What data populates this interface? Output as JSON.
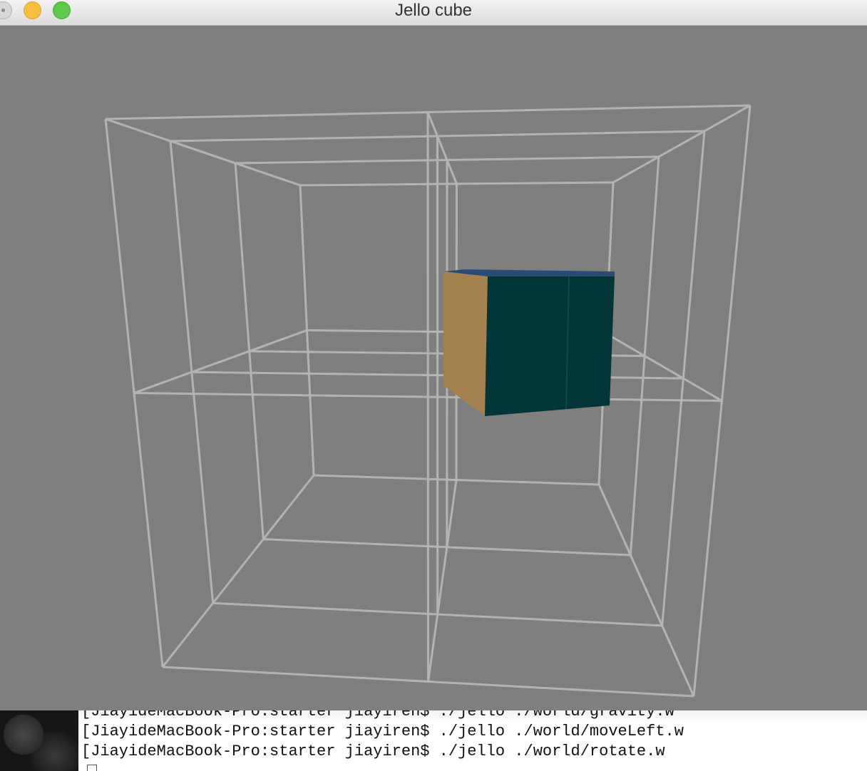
{
  "window": {
    "title": "Jello cube"
  },
  "colors": {
    "background": "#7f7f7f",
    "wireframe": "#b3b3b3",
    "cube_front": "#023537",
    "cube_side": "#a5814f",
    "cube_top": "#2a4a78"
  },
  "terminal": {
    "lines": [
      "[JiayideMacBook-Pro:starter jiayiren$ ./jello ./world/gravity.w",
      "[JiayideMacBook-Pro:starter jiayiren$ ./jello ./world/moveLeft.w",
      "[JiayideMacBook-Pro:starter jiayiren$ ./jello ./world/rotate.w"
    ]
  }
}
